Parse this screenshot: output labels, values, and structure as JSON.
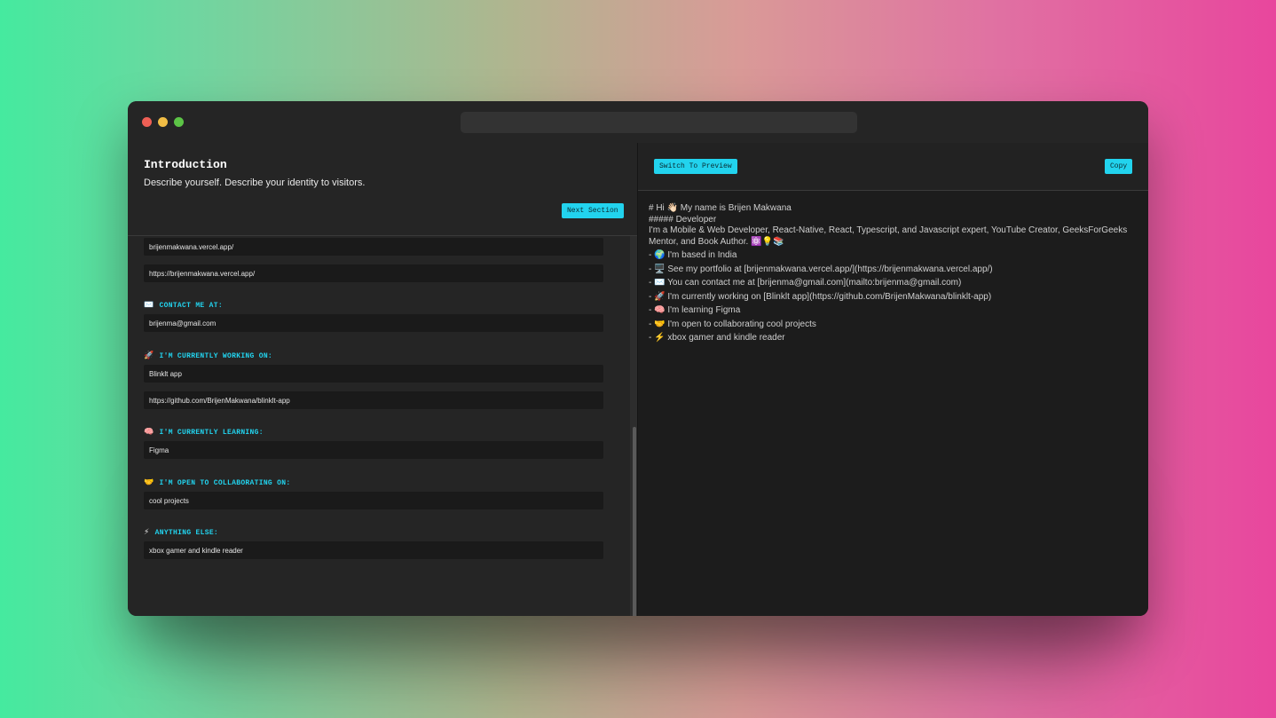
{
  "window": {
    "controls": [
      "close",
      "minimize",
      "maximize"
    ],
    "colors": {
      "close": "#ee5f55",
      "minimize": "#f1bd45",
      "maximize": "#5cc446",
      "accent": "#22d3ee"
    }
  },
  "editor": {
    "section_title": "Introduction",
    "section_description": "Describe yourself. Describe your identity to visitors.",
    "next_section_label": "Next Section",
    "fields": {
      "portfolio_text": "brijenmakwana.vercel.app/",
      "portfolio_url": "https://brijenmakwana.vercel.app/",
      "contact_email": "brijenma@gmail.com",
      "project_name": "Blinklt app",
      "project_url": "https://github.com/BrijenMakwana/blinklt-app",
      "learning": "Figma",
      "collaborating": "cool projects",
      "anything_else": "xbox gamer and kindle reader"
    },
    "labels": {
      "contact": {
        "emoji": "✉️",
        "text": "CONTACT ME AT:"
      },
      "working_on": {
        "emoji": "🚀",
        "text": "I'M CURRENTLY WORKING ON:"
      },
      "learning": {
        "emoji": "🧠",
        "text": "I'M CURRENTLY LEARNING:"
      },
      "collaborating": {
        "emoji": "🤝",
        "text": "I'M OPEN TO COLLABORATING ON:"
      },
      "anything_else": {
        "emoji": "⚡",
        "text": "ANYTHING ELSE:"
      }
    }
  },
  "preview": {
    "switch_label": "Switch To Preview",
    "copy_label": "Copy",
    "markdown": {
      "heading": "# Hi 👋🏻 My name is Brijen Makwana",
      "subheading": "##### Developer",
      "bio": "I'm a Mobile & Web Developer, React-Native, React, Typescript, and Javascript expert, YouTube Creator, GeeksForGeeks Mentor, and Book Author. ⚛️💡📚",
      "items": [
        "- 🌍 I'm based in India",
        "- 🖥️ See my portfolio at [brijenmakwana.vercel.app/](https://brijenmakwana.vercel.app/)",
        "- ✉️ You can contact me at [brijenma@gmail.com](mailto:brijenma@gmail.com)",
        "- 🚀 I'm currently working on [Blinklt app](https://github.com/BrijenMakwana/blinklt-app)",
        "- 🧠 I'm learning Figma",
        "- 🤝 I'm open to collaborating cool projects",
        "- ⚡ xbox gamer and kindle reader"
      ]
    }
  }
}
